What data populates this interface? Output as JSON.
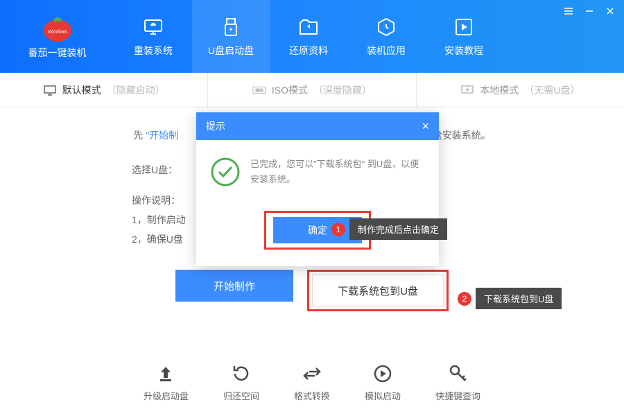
{
  "app": {
    "name": "番茄一键装机"
  },
  "nav": [
    {
      "label": "重装系统"
    },
    {
      "label": "U盘启动盘"
    },
    {
      "label": "还原资料"
    },
    {
      "label": "装机应用"
    },
    {
      "label": "安装教程"
    }
  ],
  "tabs": [
    {
      "label": "默认模式",
      "sub": "（隐藏启动）"
    },
    {
      "label": "ISO模式",
      "sub": "（深度隐藏）"
    },
    {
      "label": "本地模式",
      "sub": "（无需U盘）"
    }
  ],
  "hint": {
    "prefix": "先",
    "quote_open": "\"",
    "link1": "开始制",
    "quote_close": "\"",
    "suffix": "以便从 U盘安装系统。"
  },
  "form": {
    "select_label": "选择U盘：",
    "instructions_label": "操作说明：",
    "step1": "1，制作启动",
    "step2": "2，确保U盘"
  },
  "actions": {
    "start": "开始制作",
    "download": "下载系统包到U盘"
  },
  "callouts": {
    "c1": "制作完成后点击确定",
    "c2": "下载系统包到U盘"
  },
  "footer": [
    {
      "label": "升级启动盘"
    },
    {
      "label": "归还空间"
    },
    {
      "label": "格式转换"
    },
    {
      "label": "模拟启动"
    },
    {
      "label": "快捷键查询"
    }
  ],
  "modal": {
    "title": "提示",
    "message": "已完成，您可以\"下载系统包\" 到U盘，以便安装系统。",
    "ok": "确定"
  }
}
